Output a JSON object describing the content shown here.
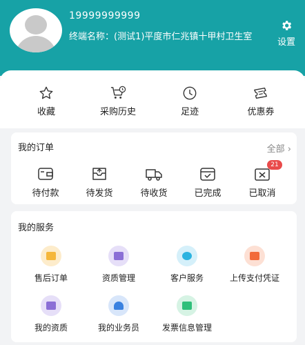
{
  "profile": {
    "phone": "19999999999",
    "terminal": "终端名称：(测试1)平度市仁兆镇十甲村卫生室"
  },
  "settings": {
    "label": "设置"
  },
  "quick_links": [
    {
      "label": "收藏",
      "icon": "star-icon"
    },
    {
      "label": "采购历史",
      "icon": "cart-history-icon"
    },
    {
      "label": "足迹",
      "icon": "clock-icon"
    },
    {
      "label": "优惠券",
      "icon": "coupon-icon"
    }
  ],
  "orders": {
    "title": "我的订单",
    "more": "全部 ›",
    "items": [
      {
        "label": "待付款",
        "icon": "wallet-icon"
      },
      {
        "label": "待发货",
        "icon": "box-icon"
      },
      {
        "label": "待收货",
        "icon": "truck-icon"
      },
      {
        "label": "已完成",
        "icon": "check-icon"
      },
      {
        "label": "已取消",
        "icon": "cancel-icon",
        "badge": "21"
      }
    ]
  },
  "services": {
    "title": "我的服务",
    "items": [
      {
        "label": "售后订单",
        "icon": "after-sales-icon",
        "color": "#f5b73b"
      },
      {
        "label": "资质管理",
        "icon": "qualification-icon",
        "color": "#8b6fd6"
      },
      {
        "label": "客户服务",
        "icon": "customer-service-icon",
        "color": "#2bb3e0"
      },
      {
        "label": "上传支付凭证",
        "icon": "upload-voucher-icon",
        "color": "#f26b3a"
      },
      {
        "label": "我的资质",
        "icon": "my-qualification-icon",
        "color": "#8b6fd6"
      },
      {
        "label": "我的业务员",
        "icon": "salesman-icon",
        "color": "#3b82e0"
      },
      {
        "label": "发票信息管理",
        "icon": "invoice-icon",
        "color": "#2fbf7a"
      }
    ]
  }
}
